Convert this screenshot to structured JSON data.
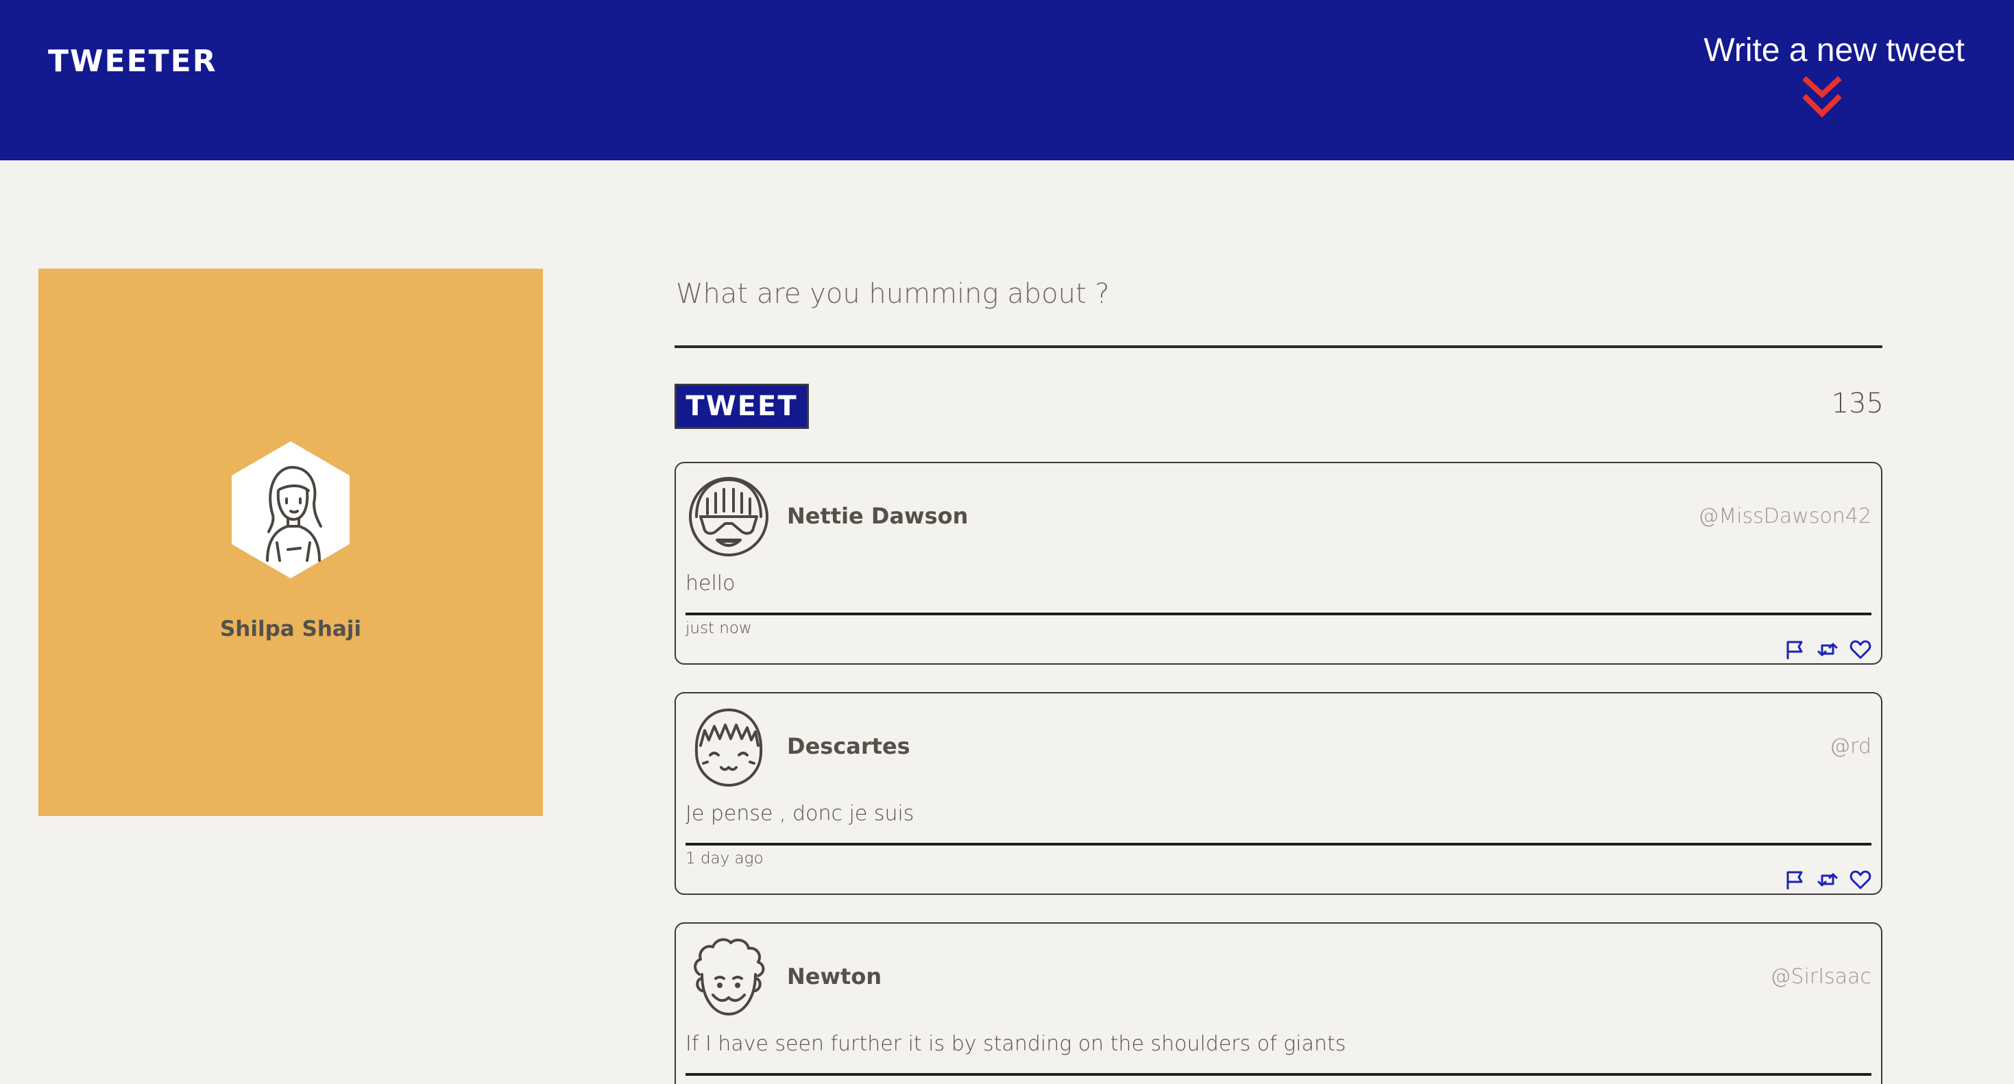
{
  "nav": {
    "brand": "TWEETER",
    "compose_label": "Write a new tweet",
    "compose_icon": "double-chevron-down-icon",
    "accent_color": "#e8322e",
    "bar_color": "#13198f"
  },
  "profile": {
    "name": "Shilpa Shaji",
    "card_color": "#ebb45b",
    "avatar_icon": "girl-avatar-icon"
  },
  "composer": {
    "placeholder": "What are you humming about ?",
    "value": "",
    "button_label": "TWEET",
    "char_counter": "135"
  },
  "tweets": [
    {
      "name": "Nettie Dawson",
      "handle": "@MissDawson42",
      "text": "hello",
      "time": "just now",
      "avatar_icon": "sunglasses-avatar-icon"
    },
    {
      "name": "Descartes",
      "handle": "@rd",
      "text": "Je pense , donc je suis",
      "time": "1 day ago",
      "avatar_icon": "smiling-face-avatar-icon"
    },
    {
      "name": "Newton",
      "handle": "@SirIsaac",
      "text": "If I have seen further it is by standing on the shoulders of giants",
      "time": "",
      "avatar_icon": "curly-hair-avatar-icon"
    }
  ],
  "tweet_actions": [
    "flag-icon",
    "retweet-icon",
    "heart-icon"
  ],
  "colors": {
    "background": "#f4f2ee",
    "text": "#545149",
    "handle": "#9a968d",
    "action_icons": "#1a22b8"
  }
}
